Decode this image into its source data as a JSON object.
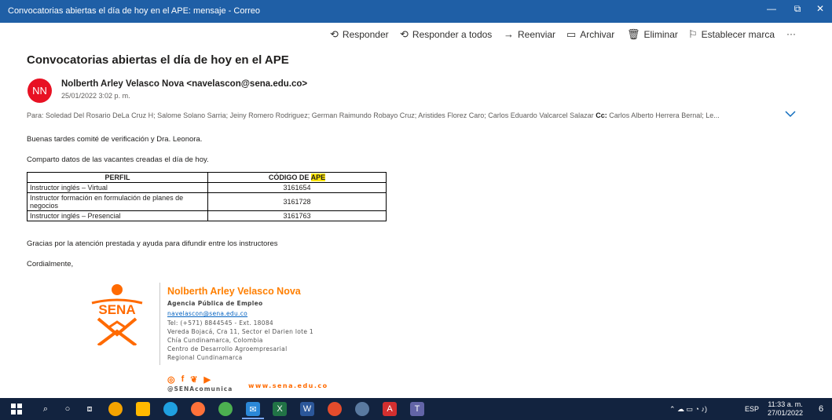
{
  "window": {
    "title": "Convocatorias abiertas el día de hoy en el APE: mensaje - Correo",
    "minimize_glyph": "—",
    "restore_glyph": "⧉",
    "close_glyph": "✕"
  },
  "toolbar": {
    "reply": "Responder",
    "reply_all": "Responder a todos",
    "forward": "Reenviar",
    "archive": "Archivar",
    "delete": "Eliminar",
    "flag": "Establecer marca",
    "more": "···"
  },
  "message": {
    "subject": "Convocatorias abiertas el día de hoy en el APE",
    "avatar_initials": "NN",
    "avatar_color": "#e81123",
    "sender": "Nolberth Arley Velasco Nova <navelascon@sena.edu.co>",
    "date": "25/01/2022 3:02 p. m.",
    "to_label": "Para:",
    "to": "Soledad Del Rosario DeLa Cruz H; Salome Solano Sarria; Jeiny Romero Rodriguez; German Raimundo Robayo Cruz; Aristides Florez Caro; Carlos Eduardo Valcarcel Salazar",
    "cc_label": "Cc:",
    "cc": "Carlos Alberto Herrera Bernal; Le..."
  },
  "body": {
    "greeting": "Buenas tardes comité de verificación y Dra. Leonora.",
    "intro": "Comparto datos de las vacantes creadas el día de hoy.",
    "thanks": "Gracias por la atención prestada y ayuda para difundir entre los instructores",
    "closing": "Cordialmente,"
  },
  "table": {
    "headers": [
      "PERFIL",
      "CÓDIGO DE ",
      "APE"
    ],
    "rows": [
      {
        "perfil": "Instructor inglés – Virtual",
        "codigo": "3161654"
      },
      {
        "perfil": "Instructor formación en formulación de planes de negocios",
        "codigo": "3161728"
      },
      {
        "perfil": "Instructor inglés – Presencial",
        "codigo": "3161763"
      }
    ]
  },
  "signature": {
    "logo_text": "SENA",
    "name": "Nolberth Arley Velasco Nova",
    "org": "Agencia Pública de Empleo",
    "email": "navelascon@sena.edu.co",
    "phone": "Tel: (+571) 8844545 - Ext. 18084",
    "address": "Vereda Bojacá, Cra 11, Sector el Darien lote 1",
    "city": "Chía Cundinamarca, Colombia",
    "center": "Centro de Desarrollo Agroempresarial",
    "region": "Regional Cundinamarca",
    "handle": "@SENAcomunica",
    "website": "www.sena.edu.co",
    "brand_color": "#ff7f00"
  },
  "taskbar": {
    "tray_lang": "ESP",
    "time": "11:33 a. m.",
    "date": "27/01/2022",
    "notification_count": "6"
  }
}
